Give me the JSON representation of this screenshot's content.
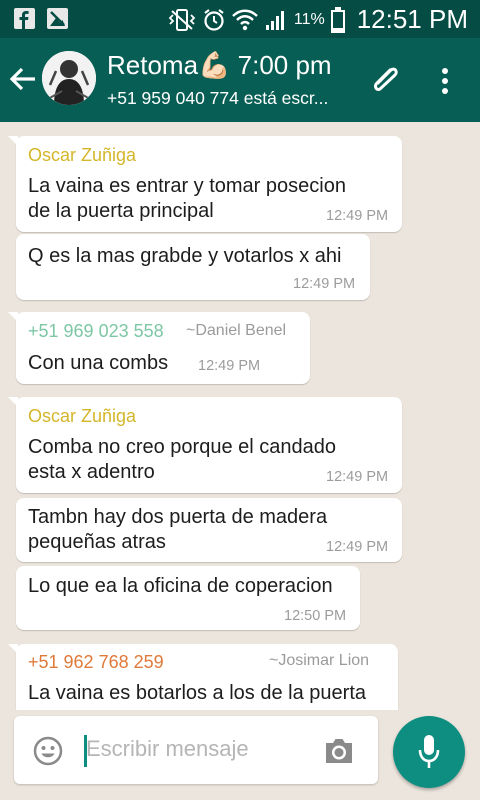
{
  "status_bar": {
    "battery_percent": "11%",
    "time": "12:51 PM"
  },
  "chat_header": {
    "title": "Retoma💪🏻 7:00 pm",
    "subtitle": "+51 959 040 774 está escr..."
  },
  "messages": [
    {
      "sender": "Oscar Zuñiga",
      "lines": [
        "La vaina es entrar y tomar posecion",
        "de la puerta principal"
      ],
      "time": "12:49 PM"
    },
    {
      "lines": [
        "Q es la mas grabde y votarlos x ahi"
      ],
      "time": "12:49 PM"
    },
    {
      "sender": "+51 969 023 558",
      "profile_name": "~Daniel Benel",
      "lines": [
        "Con una combs"
      ],
      "time": "12:49 PM"
    },
    {
      "sender": "Oscar Zuñiga",
      "lines": [
        "Comba no creo porque el candado",
        "esta x adentro"
      ],
      "time": "12:49 PM"
    },
    {
      "lines": [
        "Tambn hay dos puerta de madera",
        "pequeñas atras"
      ],
      "time": "12:49 PM"
    },
    {
      "lines": [
        "Lo que ea la oficina de coperacion"
      ],
      "time": "12:50 PM"
    },
    {
      "sender": "+51 962 768 259",
      "profile_name": "~Josimar Lion",
      "lines": [
        "La vaina es botarlos a los de la puerta"
      ]
    }
  ],
  "input": {
    "placeholder": "Escribir mensaje"
  },
  "icons": {
    "status": [
      "facebook-icon",
      "image-notification-icon",
      "vibrate-icon",
      "alarm-icon",
      "wifi-icon",
      "signal-icon",
      "battery-icon"
    ],
    "toolbar": [
      "back-arrow-icon",
      "paperclip-icon",
      "more-vert-icon"
    ],
    "input": [
      "emoji-icon",
      "camera-icon",
      "mic-icon"
    ]
  },
  "colors": {
    "status_bar": "#054d44",
    "toolbar": "#075e54",
    "accent": "#0d8e80",
    "sender_oscar": "#d4b62a",
    "sender_daniel": "#7dc7a4",
    "sender_josimar": "#e07a3a"
  }
}
